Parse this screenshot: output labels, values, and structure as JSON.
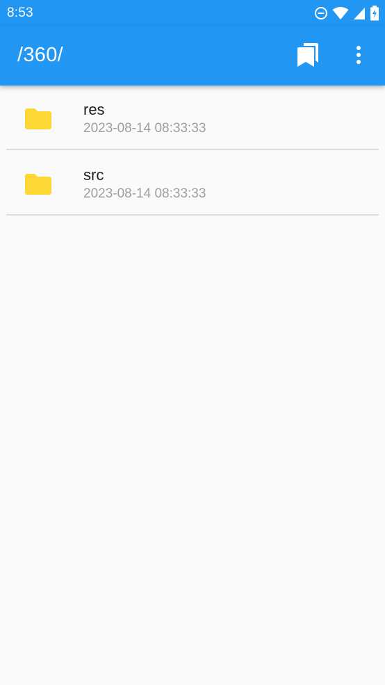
{
  "status_bar": {
    "time": "8:53",
    "icons": [
      "do-not-disturb-icon",
      "wifi-icon",
      "cell-signal-icon",
      "battery-charging-icon"
    ]
  },
  "app_bar": {
    "title": "/360/",
    "actions": [
      "bookmark-icon",
      "more-vert-icon"
    ]
  },
  "files": [
    {
      "name": "res",
      "modified": "2023-08-14 08:33:33",
      "icon": "folder-icon"
    },
    {
      "name": "src",
      "modified": "2023-08-14 08:33:33",
      "icon": "folder-icon"
    }
  ],
  "colors": {
    "primary": "#2196f3",
    "folder": "#fdd835",
    "background": "#fafafa",
    "text_primary": "#212121",
    "text_secondary": "#9e9e9e",
    "divider": "#dddddd"
  }
}
